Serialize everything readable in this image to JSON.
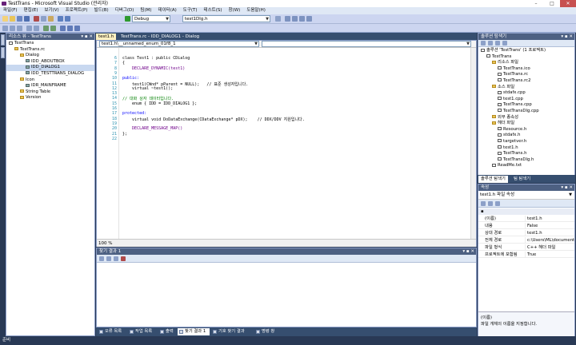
{
  "window": {
    "title": "TestTrans - Microsoft Visual Studio (관리자)",
    "min": "–",
    "max": "□",
    "close": "✕"
  },
  "menu": [
    "파일(F)",
    "편집(E)",
    "보기(V)",
    "프로젝트(P)",
    "빌드(B)",
    "디버그(D)",
    "팀(M)",
    "데이터(A)",
    "도구(T)",
    "테스트(S)",
    "창(W)",
    "도움말(H)"
  ],
  "toolbar": {
    "config": "Debug",
    "target": "test1Dlg.h"
  },
  "resource_view": {
    "title": "리소스 뷰 - TestTrans",
    "items": [
      {
        "label": "TestTrans",
        "level": 0,
        "icon": "project-icon"
      },
      {
        "label": "TestTrans.rc",
        "level": 1,
        "icon": "folder-icon"
      },
      {
        "label": "Dialog",
        "level": 2,
        "icon": "folder-icon"
      },
      {
        "label": "IDD_ABOUTBOX",
        "level": 3,
        "icon": "resource-icon"
      },
      {
        "label": "IDD_DIALOG1",
        "level": 3,
        "icon": "resource-icon",
        "selected": true
      },
      {
        "label": "IDD_TESTTRANS_DIALOG",
        "level": 3,
        "icon": "resource-icon"
      },
      {
        "label": "Icon",
        "level": 2,
        "icon": "folder-icon"
      },
      {
        "label": "IDR_MAINFRAME",
        "level": 3,
        "icon": "resource-icon"
      },
      {
        "label": "String Table",
        "level": 2,
        "icon": "folder-icon"
      },
      {
        "label": "Version",
        "level": 2,
        "icon": "folder-icon"
      }
    ]
  },
  "doc_tabs": [
    {
      "label": "test1.h",
      "active": true
    },
    {
      "label": "TestTrans.rc - IDD_DIALOG1 - Dialog",
      "active": false
    }
  ],
  "editor": {
    "nav_left": "test1.h\\__unnamed_enum_01f8_1",
    "lines": [
      {
        "n": "6",
        "text": "class Test1 : public CDialog",
        "color": "#000"
      },
      {
        "n": "7",
        "text": "{",
        "color": "#000"
      },
      {
        "n": "8",
        "text": "    DECLARE_DYNAMIC(test1)",
        "color": "#6f008a"
      },
      {
        "n": "9",
        "text": "",
        "color": "#000"
      },
      {
        "n": "10",
        "text": "public:",
        "color": "#0000ff"
      },
      {
        "n": "11",
        "text": "    test1(CWnd* pParent = NULL);   // 표준 생성자입니다.",
        "color": "#000"
      },
      {
        "n": "12",
        "text": "    virtual ~test1();",
        "color": "#000"
      },
      {
        "n": "13",
        "text": "",
        "color": "#000"
      },
      {
        "n": "14",
        "text": "// 대화 상자 데이터입니다.",
        "color": "#008000"
      },
      {
        "n": "15",
        "text": "    enum { IDD = IDD_DIALOG1 };",
        "color": "#000"
      },
      {
        "n": "16",
        "text": "",
        "color": "#000"
      },
      {
        "n": "17",
        "text": "protected:",
        "color": "#0000ff"
      },
      {
        "n": "18",
        "text": "    virtual void DoDataExchange(CDataExchange* pDX);    // DDX/DDV 지원입니다.",
        "color": "#000"
      },
      {
        "n": "19",
        "text": "",
        "color": "#000"
      },
      {
        "n": "20",
        "text": "    DECLARE_MESSAGE_MAP()",
        "color": "#6f008a"
      },
      {
        "n": "21",
        "text": "};",
        "color": "#000"
      },
      {
        "n": "22",
        "text": "",
        "color": "#000"
      }
    ],
    "zoom": "100 %"
  },
  "find_results": {
    "title": "찾기 결과 1"
  },
  "bottom_tabs": [
    "오류 목록",
    "작업 목록",
    "출력",
    "찾기 결과 1",
    "기호 찾기 결과",
    "명령 창"
  ],
  "solution_explorer": {
    "title": "솔루션 탐색기",
    "items": [
      {
        "label": "솔루션 'TestTrans' (1 프로젝트)",
        "level": 0,
        "icon": "solution-icon"
      },
      {
        "label": "TestTrans",
        "level": 1,
        "icon": "project-icon"
      },
      {
        "label": "리소스 파일",
        "level": 2,
        "icon": "folder-icon"
      },
      {
        "label": "TestTrans.ico",
        "level": 3,
        "icon": "file-icon"
      },
      {
        "label": "TestTrans.rc",
        "level": 3,
        "icon": "file-icon"
      },
      {
        "label": "TestTrans.rc2",
        "level": 3,
        "icon": "file-icon"
      },
      {
        "label": "소스 파일",
        "level": 2,
        "icon": "folder-icon"
      },
      {
        "label": "stdafx.cpp",
        "level": 3,
        "icon": "file-icon"
      },
      {
        "label": "test1.cpp",
        "level": 3,
        "icon": "file-icon"
      },
      {
        "label": "TestTrans.cpp",
        "level": 3,
        "icon": "file-icon"
      },
      {
        "label": "TestTransDlg.cpp",
        "level": 3,
        "icon": "file-icon"
      },
      {
        "label": "외부 종속성",
        "level": 2,
        "icon": "folder-icon"
      },
      {
        "label": "헤더 파일",
        "level": 2,
        "icon": "folder-icon"
      },
      {
        "label": "Resource.h",
        "level": 3,
        "icon": "file-icon"
      },
      {
        "label": "stdafx.h",
        "level": 3,
        "icon": "file-icon"
      },
      {
        "label": "targetver.h",
        "level": 3,
        "icon": "file-icon"
      },
      {
        "label": "test1.h",
        "level": 3,
        "icon": "file-icon"
      },
      {
        "label": "TestTrans.h",
        "level": 3,
        "icon": "file-icon"
      },
      {
        "label": "TestTransDlg.h",
        "level": 3,
        "icon": "file-icon"
      },
      {
        "label": "ReadMe.txt",
        "level": 2,
        "icon": "file-icon"
      }
    ],
    "tabs": [
      "솔루션 탐색기",
      "팀 탐색기"
    ]
  },
  "properties": {
    "title": "속성",
    "subject": "test1.h 파일 속성",
    "rows": [
      {
        "k": "(이름)",
        "v": "test1.h"
      },
      {
        "k": "내용",
        "v": "False"
      },
      {
        "k": "상대 경로",
        "v": "test1.h"
      },
      {
        "k": "전체 경로",
        "v": "c:\\Users\\ML\\documents"
      },
      {
        "k": "파일 형식",
        "v": "C++ 헤더 파일"
      },
      {
        "k": "프로젝트에 포함됨",
        "v": "True"
      }
    ],
    "desc_title": "(이름)",
    "desc_text": "파일 개체의 이름을 지정합니다."
  },
  "status": "준비",
  "colors": {
    "chrome": "#293955",
    "accent": "#4d6082"
  }
}
